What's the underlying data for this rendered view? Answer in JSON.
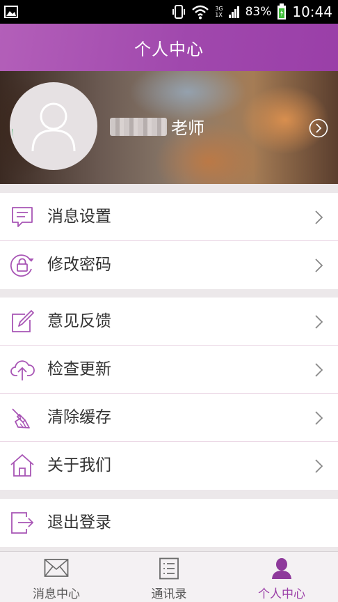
{
  "status_bar": {
    "network_top": "3G",
    "network_bottom": "1X",
    "battery": "83%",
    "time": "10:44"
  },
  "header": {
    "title": "个人中心"
  },
  "profile": {
    "name_suffix": "老师"
  },
  "groups": [
    [
      {
        "label": "消息设置",
        "icon": "message-settings-icon"
      },
      {
        "label": "修改密码",
        "icon": "lock-icon"
      }
    ],
    [
      {
        "label": "意见反馈",
        "icon": "edit-feedback-icon"
      },
      {
        "label": "检查更新",
        "icon": "cloud-upload-icon"
      },
      {
        "label": "清除缓存",
        "icon": "broom-icon"
      },
      {
        "label": "关于我们",
        "icon": "home-icon"
      }
    ],
    [
      {
        "label": "退出登录",
        "icon": "logout-icon"
      }
    ]
  ],
  "tabs": [
    {
      "label": "消息中心",
      "icon": "mail-icon",
      "active": false
    },
    {
      "label": "通讯录",
      "icon": "contacts-list-icon",
      "active": false
    },
    {
      "label": "个人中心",
      "icon": "person-icon",
      "active": true
    }
  ],
  "colors": {
    "accent": "#9b3fa8",
    "header": "#a048ad",
    "progress_ring": "#3db36b",
    "divider": "#ebd7e5"
  }
}
